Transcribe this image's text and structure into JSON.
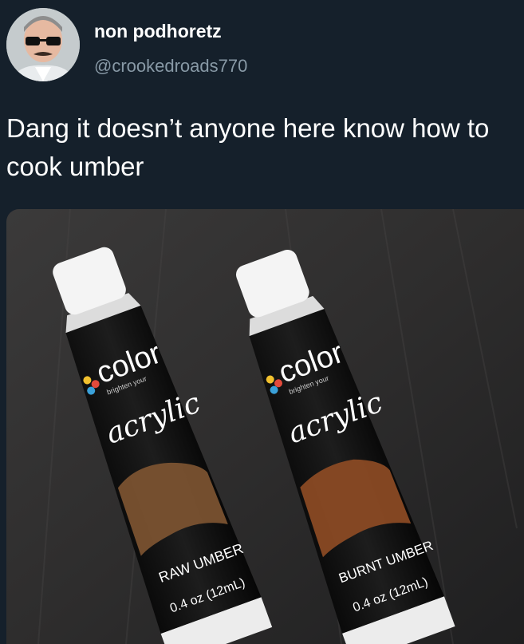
{
  "tweet": {
    "display_name": "non podhoretz",
    "handle": "@crookedroads770",
    "text": "Dang it doesn’t anyone here know how to cook umber",
    "avatar_icon": "profile-photo-avatar"
  },
  "photo": {
    "tube_left": {
      "brand": "color",
      "tagline": "brighten your",
      "type": "acrylic",
      "color_name": "RAW UMBER",
      "size": "0.4 oz (12mL)",
      "swatch_color": "#7a5230"
    },
    "tube_right": {
      "brand": "color",
      "tagline": "brighten your",
      "type": "acrylic",
      "color_name": "BURNT UMBER",
      "size": "0.4 oz (12mL)",
      "swatch_color": "#8a4a24"
    }
  },
  "colors": {
    "background": "#15202b",
    "text_primary": "#ffffff",
    "text_secondary": "#8899a6"
  }
}
